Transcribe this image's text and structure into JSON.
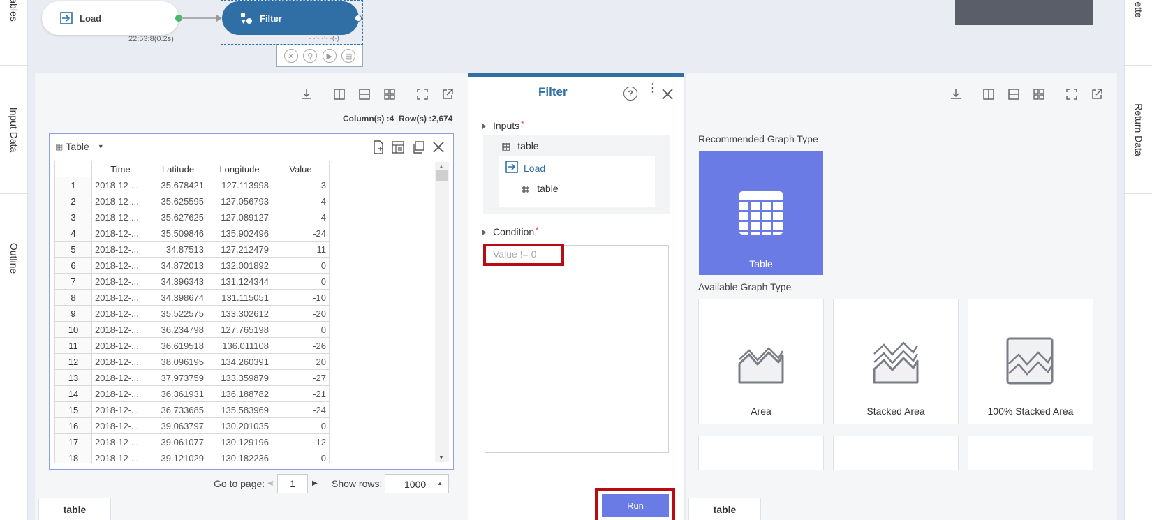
{
  "rails": {
    "left": [
      "ables",
      "Input Data",
      "Outline"
    ],
    "right": [
      "ette",
      "Return Data"
    ]
  },
  "pipeline": {
    "load_label": "Load",
    "load_time": "22:53:8(0.2s)",
    "filter_label": "Filter",
    "filter_time": "- -:- -:- -(-)"
  },
  "left_panel": {
    "columns_info": "Column(s) :4",
    "rows_info": "Row(s) :2,674",
    "view_label": "Table",
    "headers": [
      "",
      "Time",
      "Latitude",
      "Longitude",
      "Value"
    ],
    "rows": [
      [
        "1",
        "2018-12-...",
        "35.678421",
        "127.113998",
        "3"
      ],
      [
        "2",
        "2018-12-...",
        "35.625595",
        "127.056793",
        "4"
      ],
      [
        "3",
        "2018-12-...",
        "35.627625",
        "127.089127",
        "4"
      ],
      [
        "4",
        "2018-12-...",
        "35.509846",
        "135.902496",
        "-24"
      ],
      [
        "5",
        "2018-12-...",
        "34.87513",
        "127.212479",
        "11"
      ],
      [
        "6",
        "2018-12-...",
        "34.872013",
        "132.001892",
        "0"
      ],
      [
        "7",
        "2018-12-...",
        "34.396343",
        "131.124344",
        "0"
      ],
      [
        "8",
        "2018-12-...",
        "34.398674",
        "131.115051",
        "-10"
      ],
      [
        "9",
        "2018-12-...",
        "35.522575",
        "133.302612",
        "-20"
      ],
      [
        "10",
        "2018-12-...",
        "36.234798",
        "127.765198",
        "0"
      ],
      [
        "11",
        "2018-12-...",
        "36.619518",
        "136.011108",
        "-26"
      ],
      [
        "12",
        "2018-12-...",
        "38.096195",
        "134.260391",
        "20"
      ],
      [
        "13",
        "2018-12-...",
        "37.973759",
        "133.359879",
        "-27"
      ],
      [
        "14",
        "2018-12-...",
        "36.361931",
        "136.188782",
        "-21"
      ],
      [
        "15",
        "2018-12-...",
        "36.733685",
        "135.583969",
        "-24"
      ],
      [
        "16",
        "2018-12-...",
        "39.063797",
        "130.201035",
        "0"
      ],
      [
        "17",
        "2018-12-...",
        "39.061077",
        "130.129196",
        "-12"
      ],
      [
        "18",
        "2018-12-...",
        "39.121029",
        "130.182236",
        "0"
      ]
    ],
    "goto_label": "Go to page:",
    "page_value": "1",
    "show_rows_label": "Show rows:",
    "show_rows_value": "1000",
    "tab_label": "table"
  },
  "filter_panel": {
    "title": "Filter",
    "inputs_label": "Inputs",
    "input_table": "table",
    "input_source": "Load",
    "input_source_table": "table",
    "condition_label": "Condition",
    "condition_placeholder": "Value != 0",
    "run_label": "Run"
  },
  "graph_panel": {
    "recommended_label": "Recommended Graph Type",
    "recommended_item": "Table",
    "available_label": "Available Graph Type",
    "available_items": [
      "Area",
      "Stacked Area",
      "100% Stacked Area"
    ],
    "tab_label": "table"
  },
  "colors": {
    "accent": "#2f6fa6",
    "run_button": "#6b7be6",
    "highlight": "#b80c12",
    "recommended_card": "#6b7be6"
  }
}
